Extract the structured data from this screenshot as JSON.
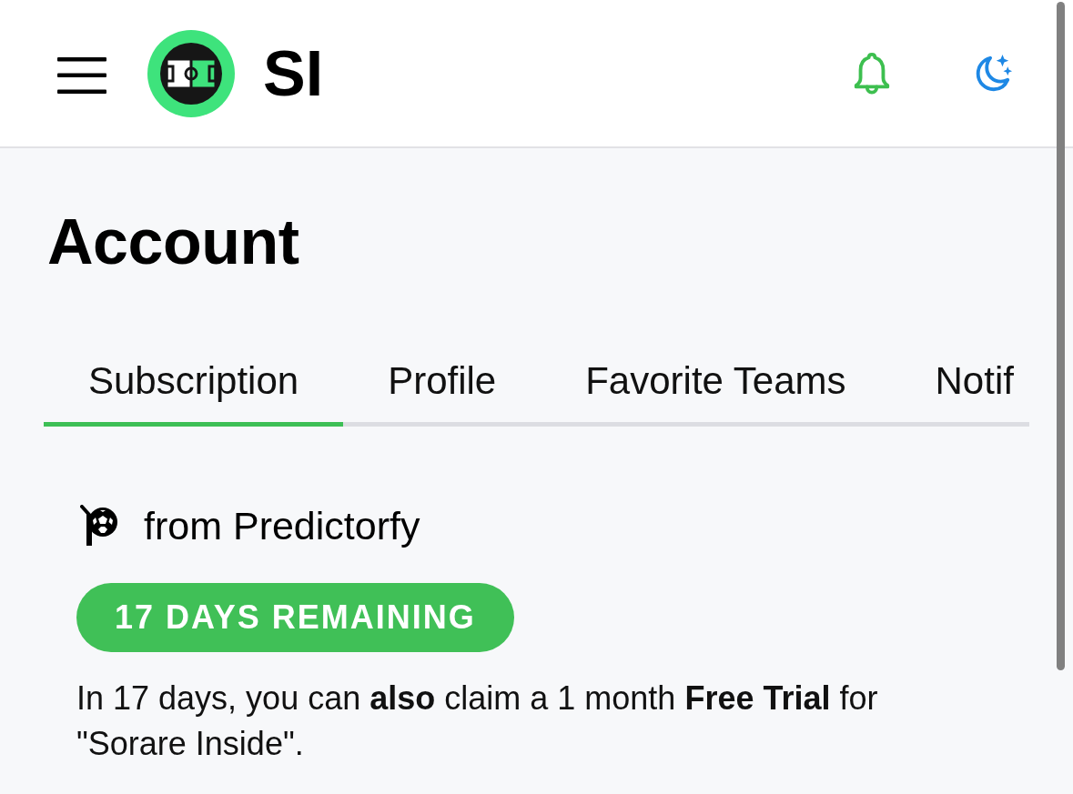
{
  "header": {
    "logo_text": "SI"
  },
  "page": {
    "title": "Account"
  },
  "tabs": [
    {
      "label": "Subscription",
      "selected": true
    },
    {
      "label": "Profile",
      "selected": false
    },
    {
      "label": "Favorite Teams",
      "selected": false
    },
    {
      "label": "Notif",
      "selected": false
    }
  ],
  "subscription": {
    "provider": "from Predictorfy",
    "badge": "17 DAYS REMAINING",
    "note": "In 17 days, you can **also** claim a 1 month **Free Trial** for \"Sorare Inside\"."
  }
}
